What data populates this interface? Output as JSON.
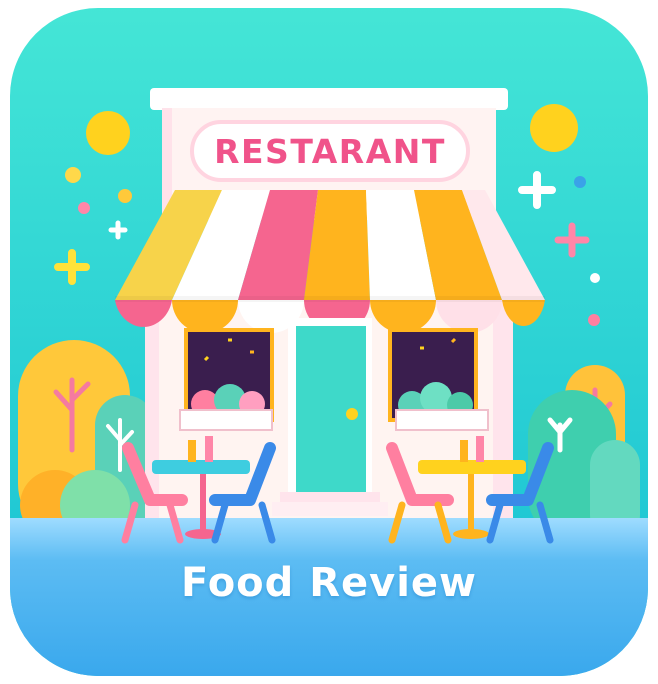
{
  "app_icon": {
    "sign_text": "RESTARANT",
    "caption": "Food Review",
    "icon_name": "restaurant-storefront-icon"
  },
  "colors": {
    "sky_top": "#3ee3d4",
    "sky_bottom": "#13c4d2",
    "ground": "#4db4f0",
    "awning_pink": "#f5658f",
    "awning_yellow": "#ffb41e",
    "door": "#3ed9c9",
    "sign_text": "#f0538a",
    "caption_text": "#ffffff"
  }
}
